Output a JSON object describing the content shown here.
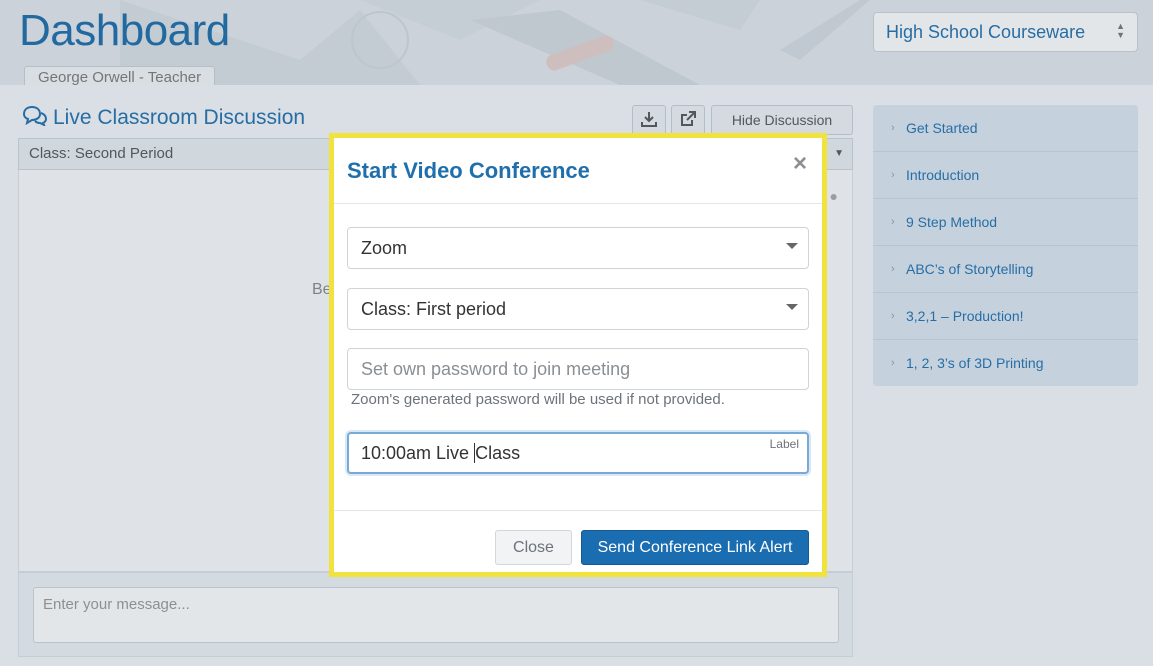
{
  "header": {
    "title": "Dashboard",
    "user": "George Orwell - Teacher",
    "course_select": "High School Courseware"
  },
  "discussion": {
    "title": "Live Classroom Discussion",
    "hide_label": "Hide Discussion",
    "class_selected": "Class: Second Period",
    "hint_fragment": "Be",
    "message_placeholder": "Enter your message..."
  },
  "sidebar": {
    "items": [
      {
        "label": "Get Started"
      },
      {
        "label": "Introduction"
      },
      {
        "label": "9 Step Method"
      },
      {
        "label": "ABC’s of Storytelling"
      },
      {
        "label": "3,2,1 – Production!"
      },
      {
        "label": "1, 2, 3’s of 3D Printing"
      }
    ]
  },
  "modal": {
    "title": "Start Video Conference",
    "close_symbol": "×",
    "platform": "Zoom",
    "class": "Class: First period",
    "password_placeholder": "Set own password to join meeting",
    "password_help": "Zoom's generated password will be used if not provided.",
    "label_tag": "Label",
    "label_value_before_cursor": "10:00am Live ",
    "label_value_after_cursor": "Class",
    "close_button": "Close",
    "send_button": "Send Conference Link Alert"
  },
  "colors": {
    "accent": "#1f6fad",
    "primary_button": "#1a6db0",
    "highlight_outline": "#f2e23d"
  }
}
